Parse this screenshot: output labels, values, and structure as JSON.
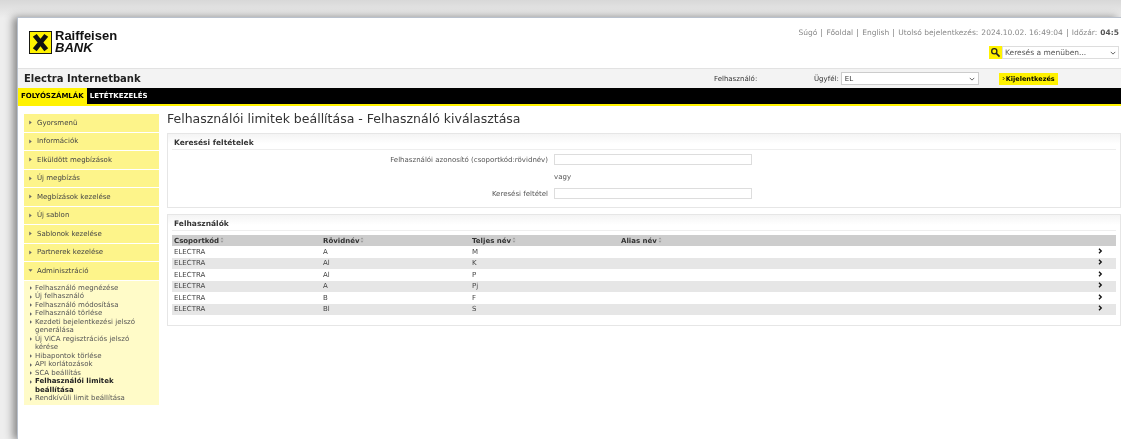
{
  "logo": {
    "line1": "Raiffeisen",
    "line2": "BANK"
  },
  "top_links": [
    {
      "label": "Súgó"
    },
    {
      "label": "Főoldal"
    },
    {
      "label": "English"
    }
  ],
  "last_login": {
    "label": "Utolsó bejelentkezés:",
    "value": "2024.10.02. 16:49:04"
  },
  "timer": {
    "label": "Időzár:",
    "value": "04:5"
  },
  "menu_search": {
    "placeholder": "Keresés a menüben..."
  },
  "app_title": "Electra Internetbank",
  "user_label": "Felhasználó:",
  "client": {
    "label": "Ügyfél:",
    "value": "EL"
  },
  "logout": "Kijelentkezés",
  "tabs": [
    {
      "label": "FOLYÓSZÁMLÁK",
      "selected": true
    },
    {
      "label": "LETÉTKEZELÉS",
      "selected": false
    }
  ],
  "sidebar": [
    {
      "label": "Gyorsmenü",
      "expanded": false
    },
    {
      "label": "Információk",
      "expanded": false
    },
    {
      "label": "Elküldött megbízások",
      "expanded": false
    },
    {
      "label": "Új megbízás",
      "expanded": false
    },
    {
      "label": "Megbízások kezelése",
      "expanded": false
    },
    {
      "label": "Új sablon",
      "expanded": false
    },
    {
      "label": "Sablonok kezelése",
      "expanded": false
    },
    {
      "label": "Partnerek kezelése",
      "expanded": false
    },
    {
      "label": "Adminisztráció",
      "expanded": true,
      "children": [
        {
          "label": "Felhasználó megnézése",
          "selected": false
        },
        {
          "label": "Új felhasználó",
          "selected": false
        },
        {
          "label": "Felhasználó módosítása",
          "selected": false
        },
        {
          "label": "Felhasználó törlése",
          "selected": false
        },
        {
          "label": "Kezdeti bejelentkezési jelszó generálása",
          "selected": false
        },
        {
          "label": "Új ViCA regisztrációs jelszó kérése",
          "selected": false
        },
        {
          "label": "Hibapontok törlése",
          "selected": false
        },
        {
          "label": "API korlátozások",
          "selected": false
        },
        {
          "label": "SCA beállítás",
          "selected": false
        },
        {
          "label": "Felhasználói limitek beállítása",
          "selected": true
        },
        {
          "label": "Rendkívüli limit beállítása",
          "selected": false
        }
      ]
    }
  ],
  "page_title": "Felhasználói limitek beállítása - Felhasználó kiválasztása",
  "search_panel": {
    "title": "Keresési feltételek",
    "id_label": "Felhasználói azonosító (csoportkód:rövidnév)",
    "or": "vagy",
    "criteria_label": "Keresési feltétel"
  },
  "users": {
    "title": "Felhasználók",
    "columns": [
      "Csoportkód",
      "Rövidnév",
      "Teljes név",
      "Alias név"
    ],
    "rows": [
      [
        "ELECTRA",
        "A",
        "M",
        ""
      ],
      [
        "ELECTRA",
        "Al",
        "K",
        ""
      ],
      [
        "ELECTRA",
        "Al",
        "P",
        ""
      ],
      [
        "ELECTRA",
        "A",
        "Pj",
        ""
      ],
      [
        "ELECTRA",
        "B",
        "F",
        ""
      ],
      [
        "ELECTRA",
        "Bl",
        "S",
        ""
      ]
    ]
  }
}
